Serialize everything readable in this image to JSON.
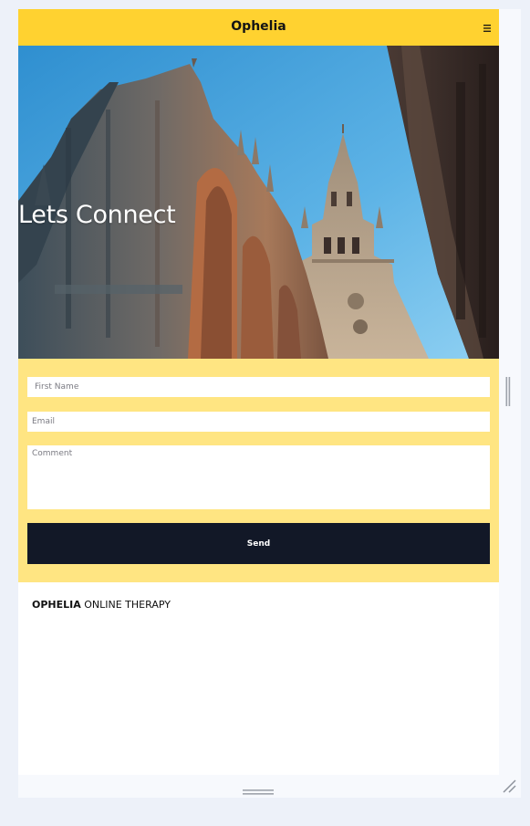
{
  "navbar": {
    "brand": "Ophelia",
    "menu_icon": "hamburger-menu-icon",
    "background": "#ffd230"
  },
  "hero": {
    "title": "Lets Connect",
    "image": "gothic-cathedral-photo"
  },
  "contact_form": {
    "background": "#ffe582",
    "first_name_placeholder": "First Name",
    "email_placeholder": "Email",
    "comment_placeholder": "Comment",
    "send_label": "Send",
    "send_color": "#121827"
  },
  "footer": {
    "brand_bold": "OPHELIA",
    "brand_rest": " ONLINE THERAPY"
  },
  "resize_handles": {
    "side_icon": "vertical-resize-handle-icon",
    "bottom_icon": "horizontal-resize-handle-icon",
    "corner_icon": "corner-resize-grip-icon"
  }
}
